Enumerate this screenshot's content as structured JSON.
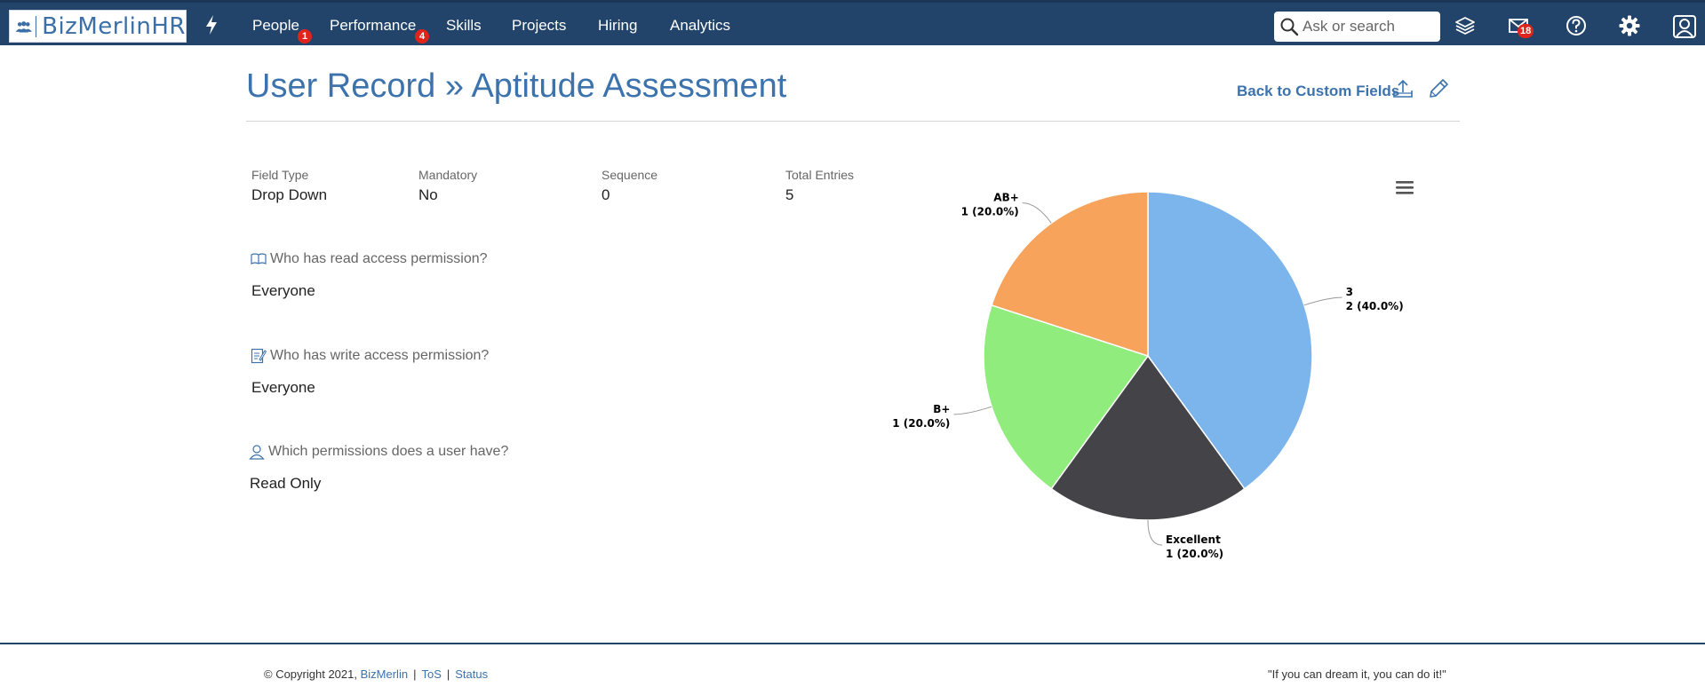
{
  "navbar": {
    "logo_text": "BizMerlinHR",
    "items": [
      {
        "label": "People",
        "badge": "1"
      },
      {
        "label": "Performance",
        "badge": "4"
      },
      {
        "label": "Skills"
      },
      {
        "label": "Projects"
      },
      {
        "label": "Hiring"
      },
      {
        "label": "Analytics"
      }
    ],
    "search_placeholder": "Ask or search",
    "mail_badge": "18"
  },
  "header": {
    "title": "User Record » Aptitude Assessment",
    "back_link": "Back to Custom Fields"
  },
  "meta": [
    {
      "label": "Field Type",
      "value": "Drop Down"
    },
    {
      "label": "Mandatory",
      "value": "No"
    },
    {
      "label": "Sequence",
      "value": "0"
    },
    {
      "label": "Total Entries",
      "value": "5"
    }
  ],
  "permissions": {
    "read_question": "Who has read access permission?",
    "read_answer": "Everyone",
    "write_question": "Who has write access permission?",
    "write_answer": "Everyone",
    "user_question": "Which permissions does a user have?",
    "user_answer": "Read Only"
  },
  "chart_data": {
    "type": "pie",
    "slices": [
      {
        "label": "3",
        "value": 2,
        "percent": "40.0%",
        "color": "#7cb5ec"
      },
      {
        "label": "Excellent",
        "value": 1,
        "percent": "20.0%",
        "color": "#434348"
      },
      {
        "label": "B+",
        "value": 1,
        "percent": "20.0%",
        "color": "#90ed7d"
      },
      {
        "label": "AB+",
        "value": 1,
        "percent": "20.0%",
        "color": "#f7a35c"
      }
    ]
  },
  "footer": {
    "copyright": "© Copyright 2021,",
    "company_link": "BizMerlin",
    "tos": "ToS",
    "status": "Status",
    "quote": "\"If you can dream it, you can do it!\""
  }
}
